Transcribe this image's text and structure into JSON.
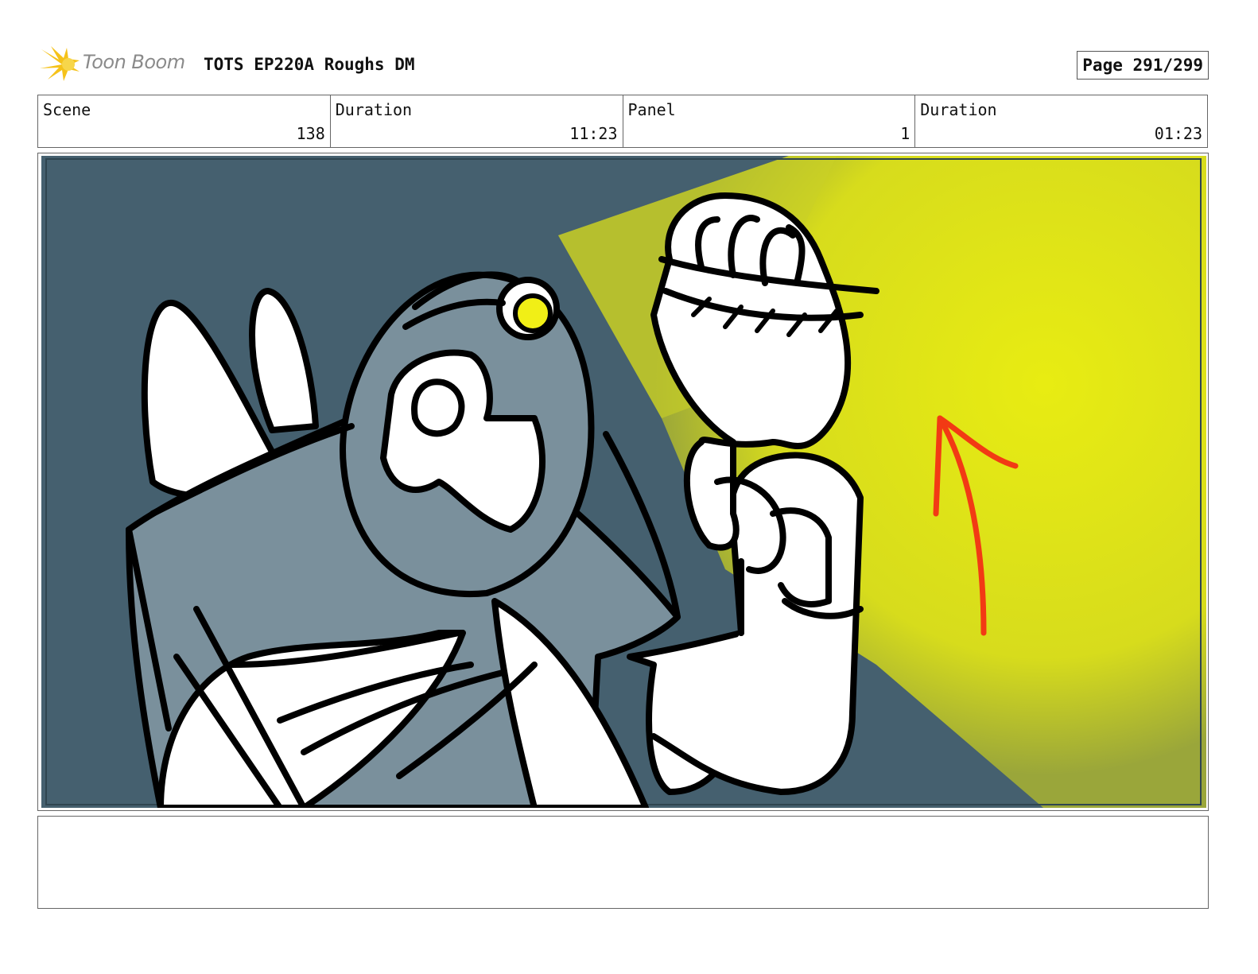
{
  "logo": {
    "text": "Toon Boom",
    "icon": "toon-boom-star-icon"
  },
  "document": {
    "title": "TOTS EP220A Roughs DM",
    "page": "Page 291/299"
  },
  "info": {
    "scene_label": "Scene",
    "scene_value": "138",
    "scene_duration_label": "Duration",
    "scene_duration_value": "11:23",
    "panel_label": "Panel",
    "panel_value": "1",
    "panel_duration_label": "Duration",
    "panel_duration_value": "01:23"
  },
  "panel": {
    "description": "",
    "colors": {
      "background": "#45606f",
      "light_beam": "#e2e814",
      "character_shade": "#7a909c",
      "arrow": "#f23a14"
    }
  },
  "notes": {
    "text": ""
  }
}
